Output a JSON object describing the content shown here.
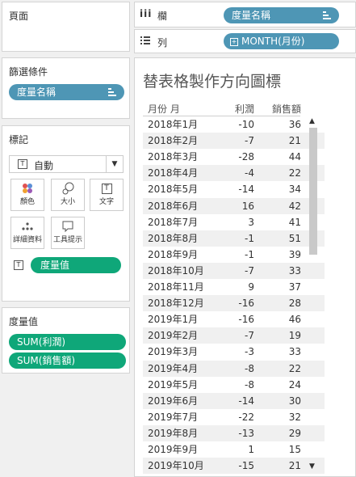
{
  "pages_card": {
    "title": "頁面"
  },
  "columns_shelf": {
    "icon": "iii",
    "label": "欄",
    "pill": "度量名稱"
  },
  "rows_shelf": {
    "icon": "list-icon",
    "label": "列",
    "pill": "MONTH(月份)"
  },
  "filters_card": {
    "title": "篩選條件",
    "pill": "度量名稱"
  },
  "marks_card": {
    "title": "標記",
    "mark_type": "自動",
    "buttons": {
      "color": "顏色",
      "size": "大小",
      "text": "文字",
      "detail": "詳細資料",
      "tooltip": "工具提示"
    },
    "text_pill": "度量值"
  },
  "measure_values_card": {
    "title": "度量值",
    "pills": [
      "SUM(利潤)",
      "SUM(銷售額)"
    ]
  },
  "view": {
    "title": "替表格製作方向圖標",
    "headers": {
      "month": "月份 月",
      "profit": "利潤",
      "sales": "銷售額"
    },
    "rows": [
      {
        "month": "2018年1月",
        "profit": "-10",
        "sales": "36"
      },
      {
        "month": "2018年2月",
        "profit": "-7",
        "sales": "21"
      },
      {
        "month": "2018年3月",
        "profit": "-28",
        "sales": "44"
      },
      {
        "month": "2018年4月",
        "profit": "-4",
        "sales": "22"
      },
      {
        "month": "2018年5月",
        "profit": "-14",
        "sales": "34"
      },
      {
        "month": "2018年6月",
        "profit": "16",
        "sales": "42"
      },
      {
        "month": "2018年7月",
        "profit": "3",
        "sales": "41"
      },
      {
        "month": "2018年8月",
        "profit": "-1",
        "sales": "51"
      },
      {
        "month": "2018年9月",
        "profit": "-1",
        "sales": "39"
      },
      {
        "month": "2018年10月",
        "profit": "-7",
        "sales": "33"
      },
      {
        "month": "2018年11月",
        "profit": "9",
        "sales": "37"
      },
      {
        "month": "2018年12月",
        "profit": "-16",
        "sales": "28"
      },
      {
        "month": "2019年1月",
        "profit": "-16",
        "sales": "46"
      },
      {
        "month": "2019年2月",
        "profit": "-7",
        "sales": "19"
      },
      {
        "month": "2019年3月",
        "profit": "-3",
        "sales": "33"
      },
      {
        "month": "2019年4月",
        "profit": "-8",
        "sales": "22"
      },
      {
        "month": "2019年5月",
        "profit": "-8",
        "sales": "24"
      },
      {
        "month": "2019年6月",
        "profit": "-14",
        "sales": "30"
      },
      {
        "month": "2019年7月",
        "profit": "-22",
        "sales": "32"
      },
      {
        "month": "2019年8月",
        "profit": "-13",
        "sales": "29"
      },
      {
        "month": "2019年9月",
        "profit": "1",
        "sales": "15"
      },
      {
        "month": "2019年10月",
        "profit": "-15",
        "sales": "21"
      }
    ]
  }
}
